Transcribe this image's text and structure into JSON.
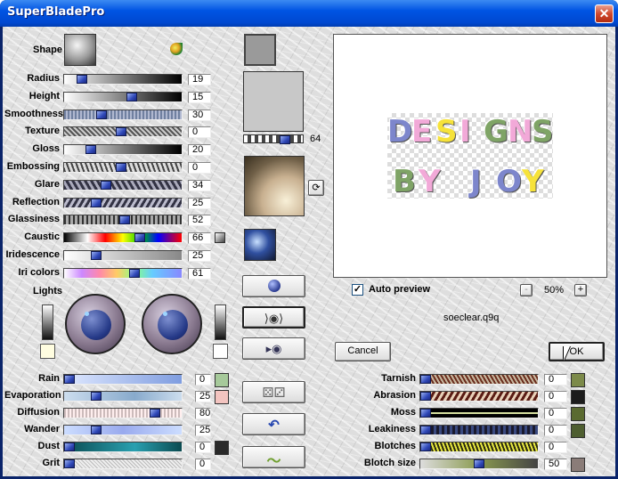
{
  "window": {
    "title": "SuperBladePro",
    "close_glyph": "✕"
  },
  "left_sliders": [
    {
      "label": "Radius",
      "value": "19",
      "fill": 0.12
    },
    {
      "label": "Height",
      "value": "15",
      "fill": 0.58
    },
    {
      "label": "Smoothness",
      "value": "30",
      "fill": 0.3
    },
    {
      "label": "Texture",
      "value": "0",
      "fill": 0.48
    },
    {
      "label": "Gloss",
      "value": "20",
      "fill": 0.2
    },
    {
      "label": "Embossing",
      "value": "0",
      "fill": 0.48
    },
    {
      "label": "Glare",
      "value": "34",
      "fill": 0.34
    },
    {
      "label": "Reflection",
      "value": "25",
      "fill": 0.25
    },
    {
      "label": "Glassiness",
      "value": "52",
      "fill": 0.52
    },
    {
      "label": "Caustic",
      "value": "66",
      "fill": 0.66
    },
    {
      "label": "Iridescence",
      "value": "25",
      "fill": 0.25
    },
    {
      "label": "Iri colors",
      "value": "61",
      "fill": 0.61
    }
  ],
  "shape_label": "Shape",
  "lights_label": "Lights",
  "bottom_left_sliders": [
    {
      "label": "Rain",
      "value": "0",
      "fill": 0.0,
      "swatch": "#a6c99a"
    },
    {
      "label": "Evaporation",
      "value": "25",
      "fill": 0.25,
      "swatch": "#f3c4c0"
    },
    {
      "label": "Diffusion",
      "value": "80",
      "fill": 0.8,
      "swatch": ""
    },
    {
      "label": "Wander",
      "value": "25",
      "fill": 0.25,
      "swatch": ""
    },
    {
      "label": "Dust",
      "value": "0",
      "fill": 0.0,
      "swatch": "#2a2a2a"
    },
    {
      "label": "Grit",
      "value": "0",
      "fill": 0.0,
      "swatch": ""
    }
  ],
  "texture_slider_value": "64",
  "preview": {
    "auto_preview_label": "Auto preview",
    "auto_preview_checked": true,
    "zoom": "50%",
    "zoom_minus": "-",
    "zoom_plus": "+",
    "preset_name": "soeclear.q9q",
    "line1": [
      "D",
      "E",
      "S",
      "I",
      "G",
      "N",
      "S"
    ],
    "line2": [
      "B",
      "Y",
      " ",
      "J",
      "O",
      "Y"
    ],
    "colors1": [
      "#7d86cc",
      "#f2a9d8",
      "#f6e23a",
      "#f2a9d8",
      "#7fa466",
      "#f2a9d8",
      "#7fa466"
    ],
    "colors2": [
      "#7fa466",
      "#f2a9d8",
      "#ffffff",
      "#7d86cc",
      "#7d86cc",
      "#f6e23a"
    ]
  },
  "buttons": {
    "cancel": "Cancel",
    "ok": "OK"
  },
  "right_sliders": [
    {
      "label": "Tarnish",
      "value": "0",
      "swatch": "#7c8a4a"
    },
    {
      "label": "Abrasion",
      "value": "0",
      "swatch": "#1c1c1c"
    },
    {
      "label": "Moss",
      "value": "0",
      "swatch": "#5a6a30"
    },
    {
      "label": "Leakiness",
      "value": "0",
      "swatch": "#4e5e30"
    },
    {
      "label": "Blotches",
      "value": "0",
      "swatch": ""
    },
    {
      "label": "Blotch size",
      "value": "50",
      "swatch": "#8a7c78"
    }
  ]
}
